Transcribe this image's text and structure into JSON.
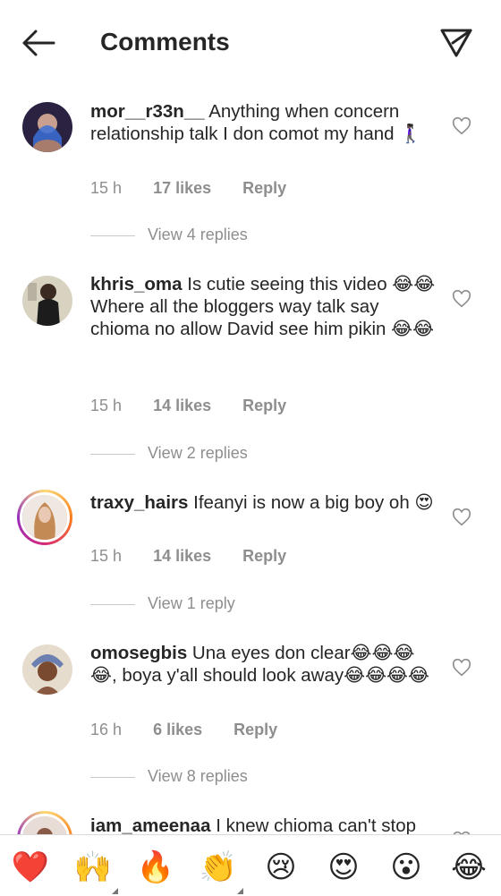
{
  "header": {
    "title": "Comments"
  },
  "comments": [
    {
      "username": "mor__r33n__",
      "text": "Anything when concern relationship talk I don comot my hand 🚶🏿‍♀️",
      "time": "15 h",
      "likes": "17 likes",
      "reply": "Reply",
      "view_replies": "View 4 replies"
    },
    {
      "username": "khris_oma",
      "text": "Is cutie seeing this video 😂😂",
      "text2": "Where all the bloggers way talk say chioma no allow David see him pikin 😂😂",
      "time": "15 h",
      "likes": "14 likes",
      "reply": "Reply",
      "view_replies": "View 2 replies"
    },
    {
      "username": "traxy_hairs",
      "text": "Ifeanyi is now a big boy oh 😍",
      "time": "15 h",
      "likes": "14 likes",
      "reply": "Reply",
      "view_replies": "View 1 reply"
    },
    {
      "username": "omosegbis",
      "text": "Una eyes don clear😂😂😂😂, boya y'all should look away😂😂😂😂",
      "time": "16 h",
      "likes": "6 likes",
      "reply": "Reply",
      "view_replies": "View 8 replies"
    },
    {
      "username": "iam_ameenaa",
      "text": "I knew chioma can't stop"
    }
  ],
  "emoji_bar": [
    "❤️",
    "🙌",
    "🔥",
    "👏",
    "😢",
    "😍",
    "😮",
    "😂"
  ]
}
